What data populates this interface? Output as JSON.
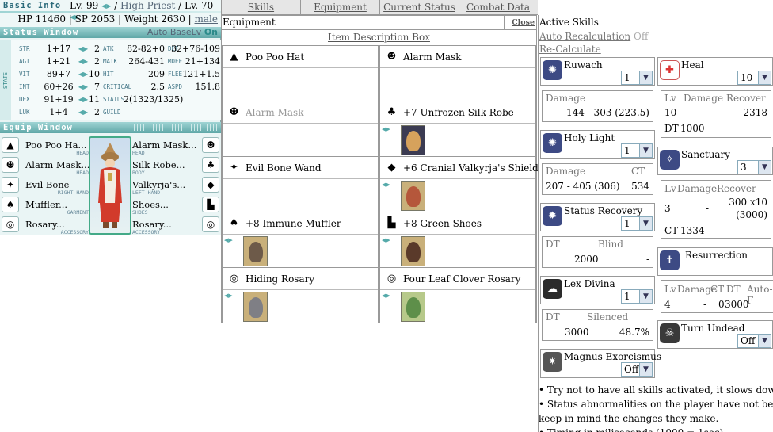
{
  "basic_info": {
    "title": "Basic Info",
    "base_level": "Lv. 99",
    "job_class": "High Priest",
    "job_level": "Lv. 70",
    "hp": "HP 11460",
    "sp": "SP 2053",
    "weight": "Weight 2630",
    "gender": "male"
  },
  "status_window": {
    "title": "Status Window",
    "auto_base_lv_label": "Auto BaseLv",
    "auto_base_lv_value": "On",
    "side_label": "STATS",
    "rows": [
      {
        "stat": "STR",
        "value": "1+17",
        "cost": "2",
        "k2": "ATK",
        "v2": "82-82+0",
        "k3": "DEF",
        "v3": "32+76-109"
      },
      {
        "stat": "AGI",
        "value": "1+21",
        "cost": "2",
        "k2": "MATK",
        "v2": "264-431",
        "k3": "MDEF",
        "v3": "21+134"
      },
      {
        "stat": "VIT",
        "value": "89+7",
        "cost": "10",
        "k2": "HIT",
        "v2": "209",
        "k3": "FLEE",
        "v3": "121+1.5"
      },
      {
        "stat": "INT",
        "value": "60+26",
        "cost": "7",
        "k2": "CRITICAL",
        "v2": "2.5",
        "k3": "ASPD",
        "v3": "151.8"
      },
      {
        "stat": "DEX",
        "value": "91+19",
        "cost": "11",
        "k2": "STATUS",
        "v2": "2(1323/1325)",
        "k3": "",
        "v3": ""
      },
      {
        "stat": "LUK",
        "value": "1+4",
        "cost": "2",
        "k2": "GUILD",
        "v2": "",
        "k3": "",
        "v3": ""
      }
    ]
  },
  "equip_window": {
    "title": "Equip Window",
    "slots": [
      {
        "name": "Poo Poo Ha...",
        "pos": "HEAD",
        "side": "l",
        "icon": "poo-poo-hat-icon",
        "glyph": "▲"
      },
      {
        "name": "Alarm Mask...",
        "pos": "HEAD",
        "side": "l",
        "icon": "alarm-mask-icon",
        "glyph": "☻"
      },
      {
        "name": "Evil Bone",
        "pos": "RIGHT HAND",
        "side": "l",
        "icon": "wand-icon",
        "glyph": "✦"
      },
      {
        "name": "Muffler...",
        "pos": "GARMENT",
        "side": "l",
        "icon": "muffler-icon",
        "glyph": "♠"
      },
      {
        "name": "Rosary...",
        "pos": "ACCESSORY",
        "side": "l",
        "icon": "rosary-icon",
        "glyph": "◎"
      },
      {
        "name": "Alarm Mask...",
        "pos": "HEAD",
        "side": "r",
        "icon": "alarm-mask-icon",
        "glyph": "☻"
      },
      {
        "name": "Silk Robe...",
        "pos": "BODY",
        "side": "r",
        "icon": "robe-icon",
        "glyph": "♣"
      },
      {
        "name": "Valkyrja's...",
        "pos": "LEFT HAND",
        "side": "r",
        "icon": "shield-icon",
        "glyph": "◆"
      },
      {
        "name": "Shoes...",
        "pos": "SHOES",
        "side": "r",
        "icon": "shoes-icon",
        "glyph": "▙"
      },
      {
        "name": "Rosary...",
        "pos": "ACCESSORY",
        "side": "r",
        "icon": "rosary-icon",
        "glyph": "◎"
      }
    ]
  },
  "tabs": [
    "Skills",
    "Equipment",
    "Current Status",
    "Combat Data"
  ],
  "equipment": {
    "title": "Equipment",
    "close": "Close",
    "desc_box": "Item Description Box",
    "items": [
      {
        "name": "Poo Poo Hat",
        "dim": false,
        "icon": "poo-poo-hat-icon",
        "glyph": "▲",
        "card": false
      },
      {
        "name": "Alarm Mask",
        "dim": false,
        "icon": "alarm-mask-icon",
        "glyph": "☻",
        "card": false
      },
      {
        "name": "Alarm Mask",
        "dim": true,
        "icon": "alarm-mask-icon",
        "glyph": "☻",
        "card": false
      },
      {
        "name": "+7 Unfrozen Silk Robe",
        "dim": false,
        "icon": "robe-icon",
        "glyph": "♣",
        "card": true,
        "card_color": "#3b3b52",
        "fig_color": "#d6a25c"
      },
      {
        "name": "Evil Bone Wand",
        "dim": false,
        "icon": "wand-icon",
        "glyph": "✦",
        "card": false
      },
      {
        "name": "+6 Cranial Valkyrja's Shield",
        "dim": false,
        "icon": "shield-icon",
        "glyph": "◆",
        "card": true,
        "card_color": "#c9b07a",
        "fig_color": "#b5573b"
      },
      {
        "name": "+8 Immune Muffler",
        "dim": false,
        "icon": "muffler-icon",
        "glyph": "♠",
        "card": true,
        "card_color": "#c9b07a",
        "fig_color": "#6d5a49"
      },
      {
        "name": "+8 Green Shoes",
        "dim": false,
        "icon": "shoes-icon",
        "glyph": "▙",
        "card": true,
        "card_color": "#c9b07a",
        "fig_color": "#5a3a2a"
      },
      {
        "name": "Hiding Rosary",
        "dim": false,
        "icon": "rosary-icon",
        "glyph": "◎",
        "card": true,
        "card_color": "#c9b07a",
        "fig_color": "#7f7f85"
      },
      {
        "name": "Four Leaf Clover Rosary",
        "dim": false,
        "icon": "rosary-icon",
        "glyph": "◎",
        "card": true,
        "card_color": "#b7c98a",
        "fig_color": "#5e8f4a"
      }
    ]
  },
  "active_skills": {
    "title": "Active Skills",
    "auto_recalc_label": "Auto Recalculation",
    "auto_recalc_value": "Off",
    "recalc_button": "Re-Calculate",
    "ruwach": {
      "name": "Ruwach",
      "level": "1",
      "h_damage": "Damage",
      "damage": "144 - 303 (223.5)"
    },
    "heal": {
      "name": "Heal",
      "level": "10",
      "h_lv": "Lv",
      "h_damage": "Damage",
      "h_recover": "Recover",
      "lv": "10",
      "damage": "-",
      "recover": "2318",
      "dt_label": "DT",
      "dt": "1000"
    },
    "holy_light": {
      "name": "Holy Light",
      "level": "1",
      "h_damage": "Damage",
      "h_ct": "CT",
      "damage": "207 - 405 (306)",
      "ct": "534"
    },
    "sanctuary": {
      "name": "Sanctuary",
      "level": "3",
      "h_lv": "Lv",
      "h_damage": "Damage",
      "h_recover": "Recover",
      "lv": "3",
      "damage": "-",
      "recover": "300 x10",
      "recover2": "(3000)",
      "ct_label": "CT",
      "ct": "1334"
    },
    "status_recovery": {
      "name": "Status Recovery",
      "level": "1",
      "h_dt": "DT",
      "h_blind": "Blind",
      "dt": "2000",
      "blind": "-"
    },
    "resurrection": {
      "name": "Resurrection",
      "h_lv": "Lv",
      "h_damage": "Damage",
      "h_ct": "CT",
      "h_dt": "DT",
      "h_auto": "Auto-F",
      "lv": "4",
      "damage": "-",
      "ct": "0",
      "dt": "3000"
    },
    "lex_divina": {
      "name": "Lex Divina",
      "level": "1",
      "h_dt": "DT",
      "h_silenced": "Silenced",
      "dt": "3000",
      "silenced": "48.7%"
    },
    "turn_undead": {
      "name": "Turn Undead",
      "level": "Off"
    },
    "magnus": {
      "name": "Magnus Exorcismus",
      "level": "Off"
    },
    "notes": [
      "• Try not to have all skills activated, it slows down performan",
      "• Status abnormalities on the player have not been considered,",
      "keep in mind the changes they make.",
      "• Timing in miliseconds (1000 = 1sec)"
    ]
  }
}
